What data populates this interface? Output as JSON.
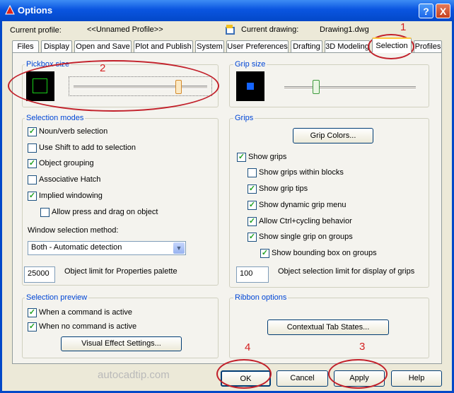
{
  "window": {
    "title": "Options",
    "help_icon": "?",
    "close_icon": "X"
  },
  "profile": {
    "current_profile_label": "Current profile:",
    "current_profile_value": "<<Unnamed Profile>>",
    "current_drawing_label": "Current drawing:",
    "current_drawing_value": "Drawing1.dwg"
  },
  "tabs": [
    {
      "label": "Files"
    },
    {
      "label": "Display"
    },
    {
      "label": "Open and Save"
    },
    {
      "label": "Plot and Publish"
    },
    {
      "label": "System"
    },
    {
      "label": "User Preferences"
    },
    {
      "label": "Drafting"
    },
    {
      "label": "3D Modeling"
    },
    {
      "label": "Selection",
      "active": true
    },
    {
      "label": "Profiles"
    }
  ],
  "pickbox": {
    "label": "Pickbox size",
    "slider_level": 0.8
  },
  "grip_size": {
    "label": "Grip size",
    "slider_level": 0.23
  },
  "selection_modes": {
    "label": "Selection modes",
    "items": [
      {
        "label": "Noun/verb selection",
        "checked": true
      },
      {
        "label": "Use Shift to add to selection",
        "checked": false
      },
      {
        "label": "Object grouping",
        "checked": true
      },
      {
        "label": "Associative Hatch",
        "checked": false
      },
      {
        "label": "Implied windowing",
        "checked": true
      },
      {
        "label": "Allow press and drag on object",
        "checked": false
      }
    ],
    "window_method_label": "Window selection method:",
    "window_method_value": "Both - Automatic detection",
    "object_limit_value": "25000",
    "object_limit_label": "Object limit for Properties palette"
  },
  "grips": {
    "label": "Grips",
    "grip_colors_button": "Grip Colors...",
    "items": [
      {
        "label": "Show grips",
        "checked": true
      },
      {
        "label": "Show grips within blocks",
        "checked": false
      },
      {
        "label": "Show grip tips",
        "checked": true
      },
      {
        "label": "Show dynamic grip menu",
        "checked": true
      },
      {
        "label": "Allow Ctrl+cycling behavior",
        "checked": true
      },
      {
        "label": "Show single grip on groups",
        "checked": true
      },
      {
        "label": "Show bounding box on groups",
        "checked": true
      }
    ],
    "selection_limit_value": "100",
    "selection_limit_label": "Object selection limit for display of grips"
  },
  "selection_preview": {
    "label": "Selection preview",
    "items": [
      {
        "label": "When a command is active",
        "checked": true
      },
      {
        "label": "When no command is active",
        "checked": true
      }
    ],
    "visual_effect_button": "Visual Effect Settings..."
  },
  "ribbon": {
    "label": "Ribbon options",
    "contextual_button": "Contextual Tab States..."
  },
  "buttons": {
    "ok": "OK",
    "cancel": "Cancel",
    "apply": "Apply",
    "help": "Help"
  },
  "annotations": {
    "n1": "1",
    "n2": "2",
    "n3": "3",
    "n4": "4"
  },
  "watermark": "autocadtip.com",
  "colors": {
    "title_bar": "#0a55e0",
    "group_label": "#0046d5",
    "annotation": "#c2202a",
    "grip_blue": "#1464ff",
    "pickbox_green": "#18d018"
  }
}
